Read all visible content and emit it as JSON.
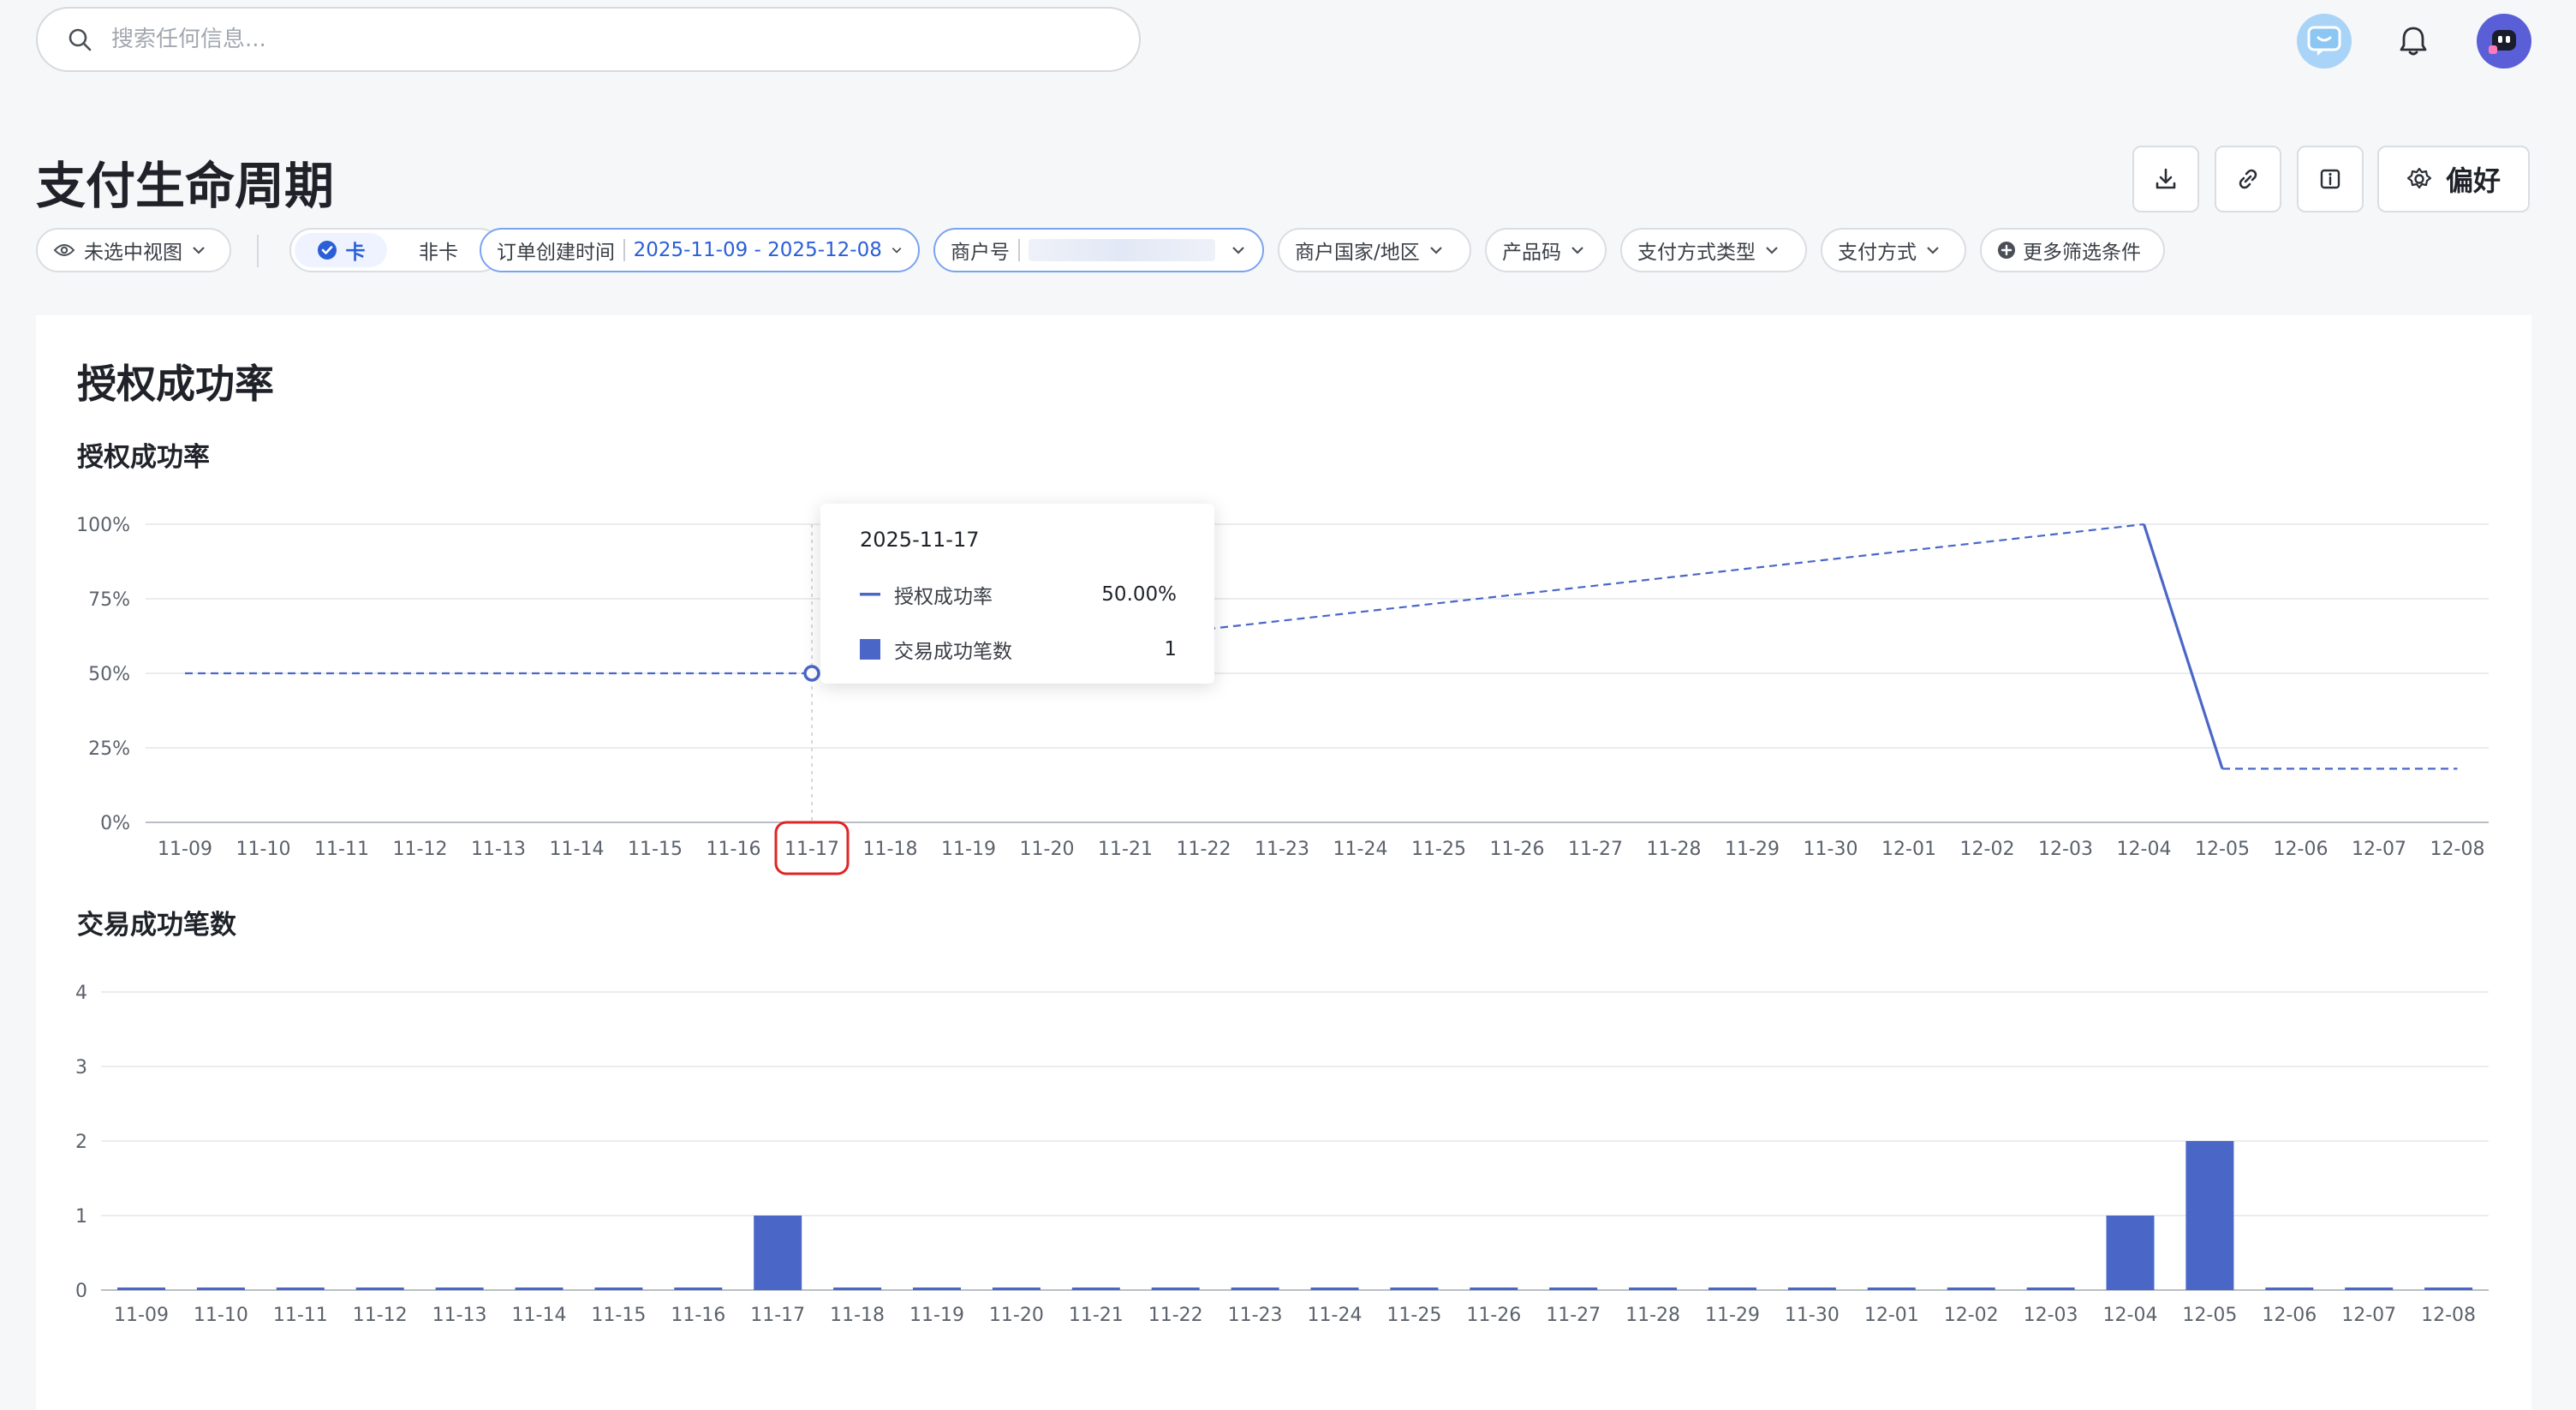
{
  "search": {
    "placeholder": "搜索任何信息..."
  },
  "header": {
    "title": "支付生命周期",
    "preferences_label": "偏好"
  },
  "filters": {
    "view": "未选中视图",
    "card_on": "卡",
    "card_off": "非卡",
    "order_time_label": "订单创建时间",
    "order_time_value": "2025-11-09 - 2025-12-08",
    "merchant_label": "商户号",
    "country": "商户国家/地区",
    "product_code": "产品码",
    "payment_method_type": "支付方式类型",
    "payment_method": "支付方式",
    "more": "更多筛选条件"
  },
  "card": {
    "title": "授权成功率"
  },
  "tooltip": {
    "date": "2025-11-17",
    "rows": [
      {
        "name": "授权成功率",
        "value": "50.00%"
      },
      {
        "name": "交易成功笔数",
        "value": "1"
      }
    ]
  },
  "colors": {
    "series": "#4a67c8",
    "accent": "#2a5fd6",
    "highlight": "#e02424"
  },
  "chart_data": [
    {
      "type": "line",
      "title": "授权成功率",
      "x": [
        "11-09",
        "11-10",
        "11-11",
        "11-12",
        "11-13",
        "11-14",
        "11-15",
        "11-16",
        "11-17",
        "11-18",
        "11-19",
        "11-20",
        "11-21",
        "11-22",
        "11-23",
        "11-24",
        "11-25",
        "11-26",
        "11-27",
        "11-28",
        "11-29",
        "11-30",
        "12-01",
        "12-02",
        "12-03",
        "12-04",
        "12-05",
        "12-06",
        "12-07",
        "12-08"
      ],
      "y_ticks": [
        "0%",
        "25%",
        "50%",
        "75%",
        "100%"
      ],
      "ylim": [
        0,
        100
      ],
      "points": [
        {
          "x": "11-17",
          "y": 50
        },
        {
          "x": "12-04",
          "y": 100
        },
        {
          "x": "12-05",
          "y": 18
        }
      ],
      "grid": true,
      "highlight_x": "11-17"
    },
    {
      "type": "bar",
      "title": "交易成功笔数",
      "categories": [
        "11-09",
        "11-10",
        "11-11",
        "11-12",
        "11-13",
        "11-14",
        "11-15",
        "11-16",
        "11-17",
        "11-18",
        "11-19",
        "11-20",
        "11-21",
        "11-22",
        "11-23",
        "11-24",
        "11-25",
        "11-26",
        "11-27",
        "11-28",
        "11-29",
        "11-30",
        "12-01",
        "12-02",
        "12-03",
        "12-04",
        "12-05",
        "12-06",
        "12-07",
        "12-08"
      ],
      "values": [
        0,
        0,
        0,
        0,
        0,
        0,
        0,
        0,
        1,
        0,
        0,
        0,
        0,
        0,
        0,
        0,
        0,
        0,
        0,
        0,
        0,
        0,
        0,
        0,
        0,
        1,
        2,
        0,
        0,
        0
      ],
      "y_ticks": [
        "0",
        "1",
        "2",
        "3",
        "4"
      ],
      "ylim": [
        0,
        4
      ],
      "grid": true
    }
  ]
}
